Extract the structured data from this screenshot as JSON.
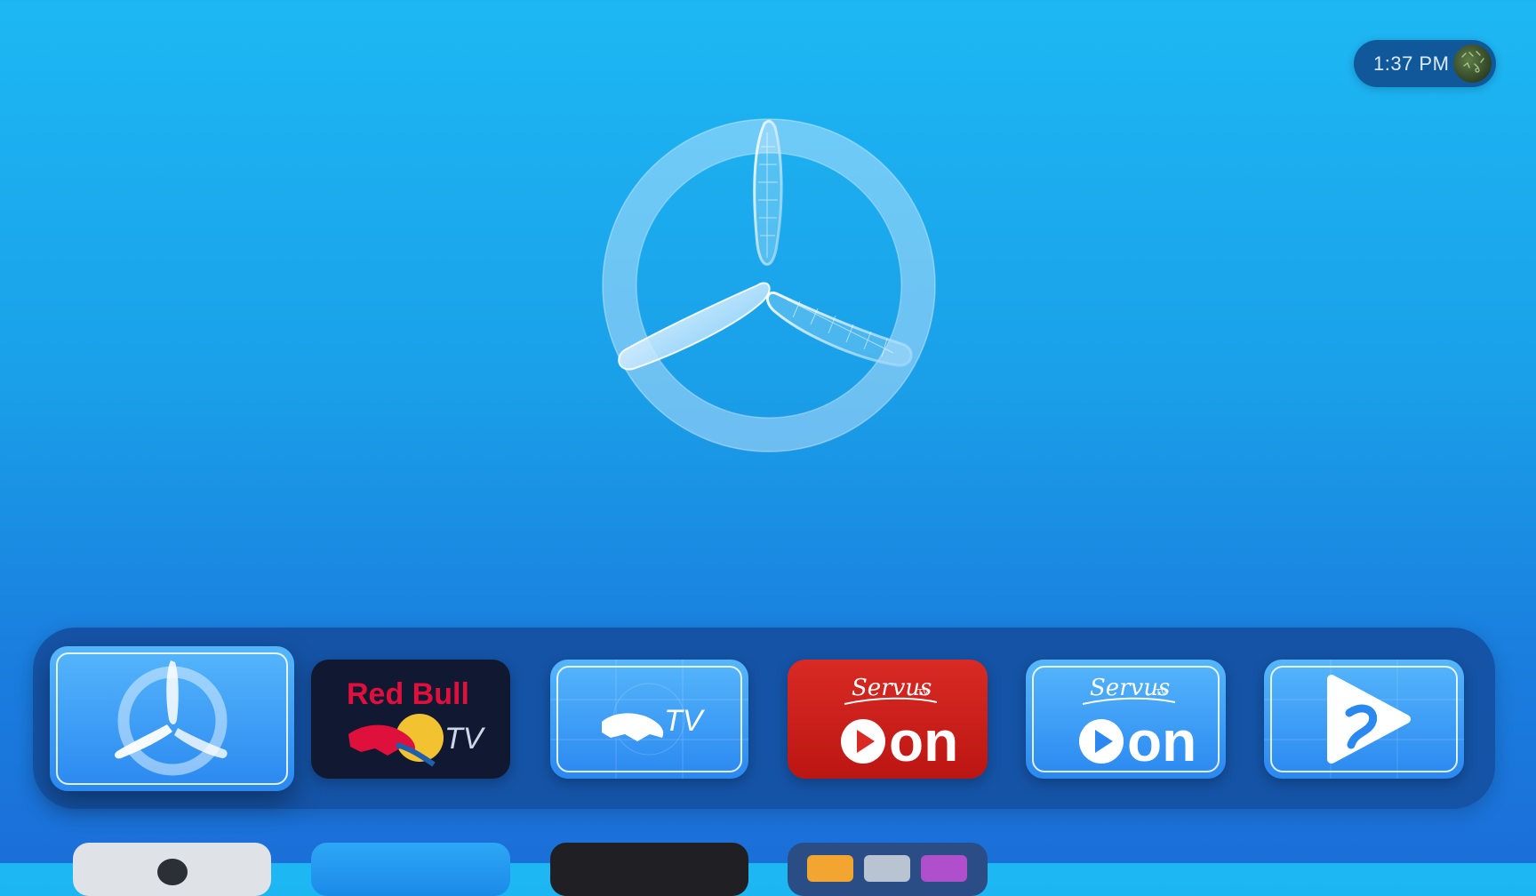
{
  "status_bar": {
    "time": "1:37 PM",
    "avatar_icon": "profile-avatar-icon"
  },
  "hero": {
    "icon": "propeller-app-logo-icon"
  },
  "top_shelf": {
    "apps": [
      {
        "name": "propeller-app",
        "icon": "propeller-icon",
        "focused": true
      },
      {
        "name": "red-bull-tv",
        "icon": "red-bull-tv-icon",
        "line1": "Red Bull",
        "line2": "TV"
      },
      {
        "name": "red-bull-tv-blue",
        "icon": "bull-tv-icon",
        "tv_label": "TV"
      },
      {
        "name": "servus-tv-on-red",
        "icon": "servus-tv-on-icon",
        "script": "Servus",
        "tv": "TV",
        "on": "on"
      },
      {
        "name": "servus-tv-on-blue",
        "icon": "servus-tv-on-icon",
        "script": "Servus",
        "tv": "TV",
        "on": "on"
      },
      {
        "name": "play-app",
        "icon": "play-arrow-icon"
      }
    ]
  },
  "second_row": {
    "apps": [
      {
        "name": "app-light"
      },
      {
        "name": "app-blue"
      },
      {
        "name": "app-dark"
      },
      {
        "name": "app-folder"
      }
    ]
  },
  "colors": {
    "bg_top": "#1db8f4",
    "bg_bottom": "#1b6fd8",
    "dock": "#1553a6",
    "servus_red": "#d92a24",
    "redbull_red": "#e0103c",
    "redbull_yellow": "#f2c230"
  }
}
